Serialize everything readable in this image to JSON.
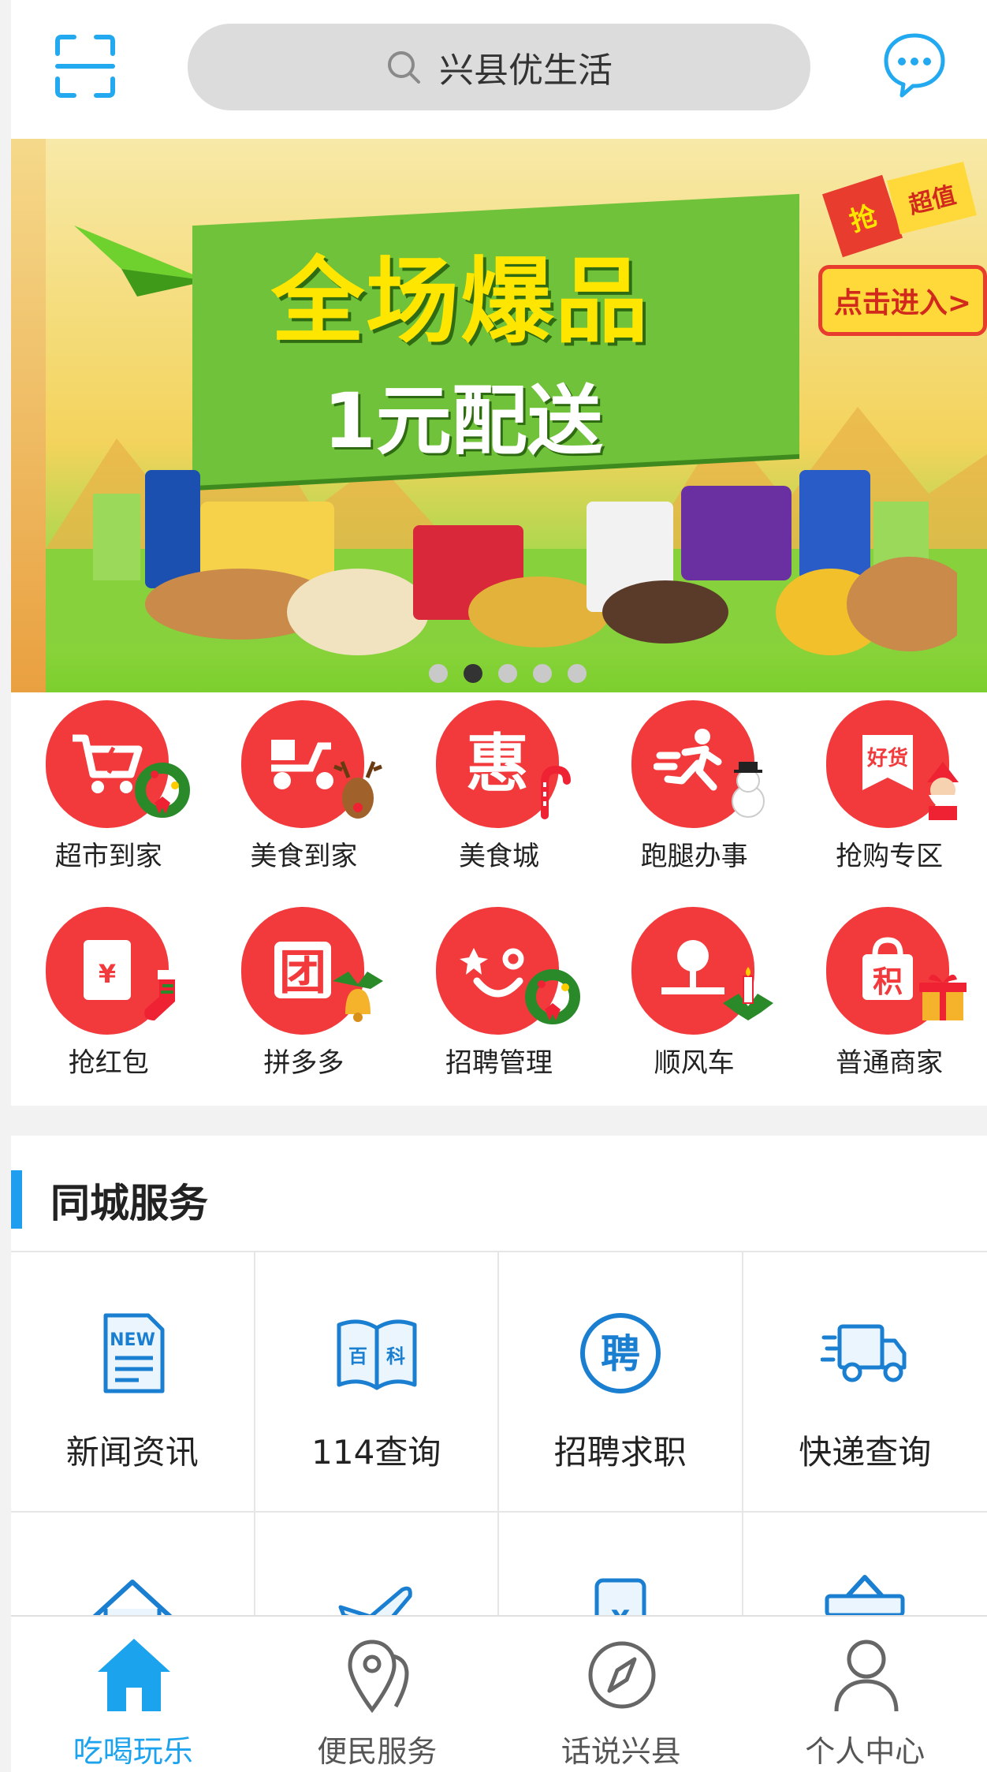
{
  "header": {
    "search_text": "兴县优生活"
  },
  "banner": {
    "headline_main": "全场爆品",
    "headline_sub": "1元配送",
    "cta": "点击进入>",
    "badge_grab": "抢",
    "badge_value": "超值",
    "active_slide": 2,
    "slide_count": 5
  },
  "quick_entries": [
    {
      "label": "超市到家",
      "icon": "shopping-cart-icon"
    },
    {
      "label": "美食到家",
      "icon": "scooter-icon"
    },
    {
      "label": "美食城",
      "icon": "discount-icon"
    },
    {
      "label": "跑腿办事",
      "icon": "runner-icon"
    },
    {
      "label": "抢购专区",
      "icon": "good-goods-icon"
    },
    {
      "label": "抢红包",
      "icon": "red-envelope-icon"
    },
    {
      "label": "拼多多",
      "icon": "group-buy-icon"
    },
    {
      "label": "招聘管理",
      "icon": "smile-face-icon"
    },
    {
      "label": "顺风车",
      "icon": "ride-share-icon"
    },
    {
      "label": "普通商家",
      "icon": "points-bag-icon"
    }
  ],
  "section": {
    "title": "同城服务"
  },
  "services": [
    {
      "label": "新闻资讯",
      "icon": "news-icon"
    },
    {
      "label": "114查询",
      "icon": "encyclopedia-icon"
    },
    {
      "label": "招聘求职",
      "icon": "job-icon"
    },
    {
      "label": "快递查询",
      "icon": "delivery-truck-icon"
    },
    {
      "label": "",
      "icon": "house-icon"
    },
    {
      "label": "",
      "icon": "plane-icon"
    },
    {
      "label": "",
      "icon": "phone-yuan-icon"
    },
    {
      "label": "",
      "icon": "shop-icon"
    }
  ],
  "tabs": [
    {
      "label": "吃喝玩乐",
      "icon": "home-icon",
      "active": true
    },
    {
      "label": "便民服务",
      "icon": "location-pin-icon",
      "active": false
    },
    {
      "label": "话说兴县",
      "icon": "compass-icon",
      "active": false
    },
    {
      "label": "个人中心",
      "icon": "person-icon",
      "active": false
    }
  ],
  "colors": {
    "accent_blue": "#1ba3ee",
    "entry_red": "#f23a3c",
    "search_bg": "#dcdcdc",
    "section_bar": "#1f9ef0"
  }
}
